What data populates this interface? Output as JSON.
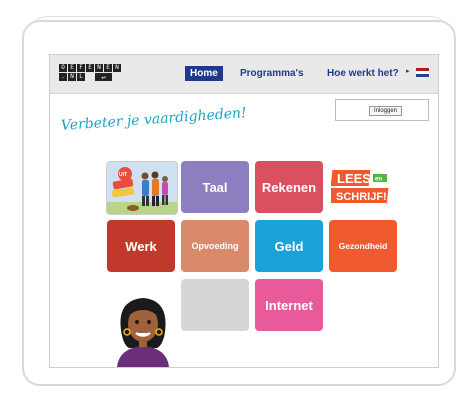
{
  "logo": {
    "row1": [
      "O",
      "E",
      "F",
      "E",
      "N",
      "E",
      "N"
    ],
    "row2": [
      ".",
      "N",
      "L"
    ]
  },
  "nav": {
    "home": "Home",
    "programmas": "Programma's",
    "hoe_werkt_het": "Hoe werkt het?",
    "language_arrow": "▸"
  },
  "header": {
    "tagline": "Verbeter je vaardigheden!",
    "login_label": "Inloggen"
  },
  "tiles": {
    "uit_thuis": "UIT DE THUIS",
    "taal": "Taal",
    "rekenen": "Rekenen",
    "lees_schrijf": "LEES en SCHRIJF!",
    "werk": "Werk",
    "opvoeding": "Opvoeding",
    "geld": "Geld",
    "gezondheid": "Gezondheid",
    "internet": "Internet"
  },
  "colors": {
    "taal": "#8d7ec0",
    "rekenen": "#d9515e",
    "werk": "#c0392b",
    "opvoeding": "#d88a6a",
    "geld": "#1ba3d9",
    "gezondheid": "#ef5a2f",
    "empty": "#d6d6d6",
    "internet": "#e95a9b",
    "nav_blue": "#1f3a8a",
    "tagline": "#1ba3c6"
  }
}
